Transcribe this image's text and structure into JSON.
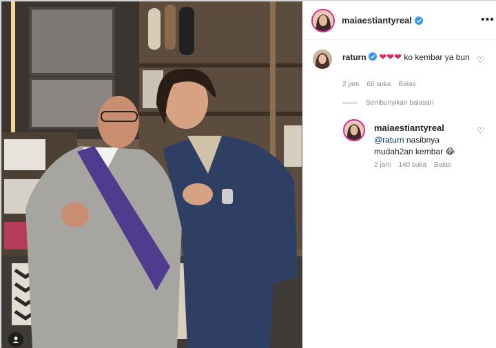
{
  "post": {
    "author": "maiaestiantyreal",
    "author_verified": true,
    "more_icon": "ellipsis-icon"
  },
  "comment": {
    "username": "raturn",
    "verified": true,
    "hearts": "❤❤❤",
    "text": "ko kembar ya bun",
    "time": "2 jam",
    "likes": "66 suka",
    "reply_label": "Balas"
  },
  "replies_toggle": {
    "label": "Sembunyikan balasan"
  },
  "reply": {
    "username": "maiaestiantyreal",
    "mention": "@raturn",
    "text": "nasibnya mudah2an kembar",
    "emoji": "😂",
    "time": "2 jam",
    "likes": "140 suka",
    "reply_label": "Balas"
  },
  "colors": {
    "verified_blue": "#3897f0",
    "heart_red": "#ed4956",
    "meta_gray": "#8e8e8e",
    "mention_blue": "#00376b"
  }
}
